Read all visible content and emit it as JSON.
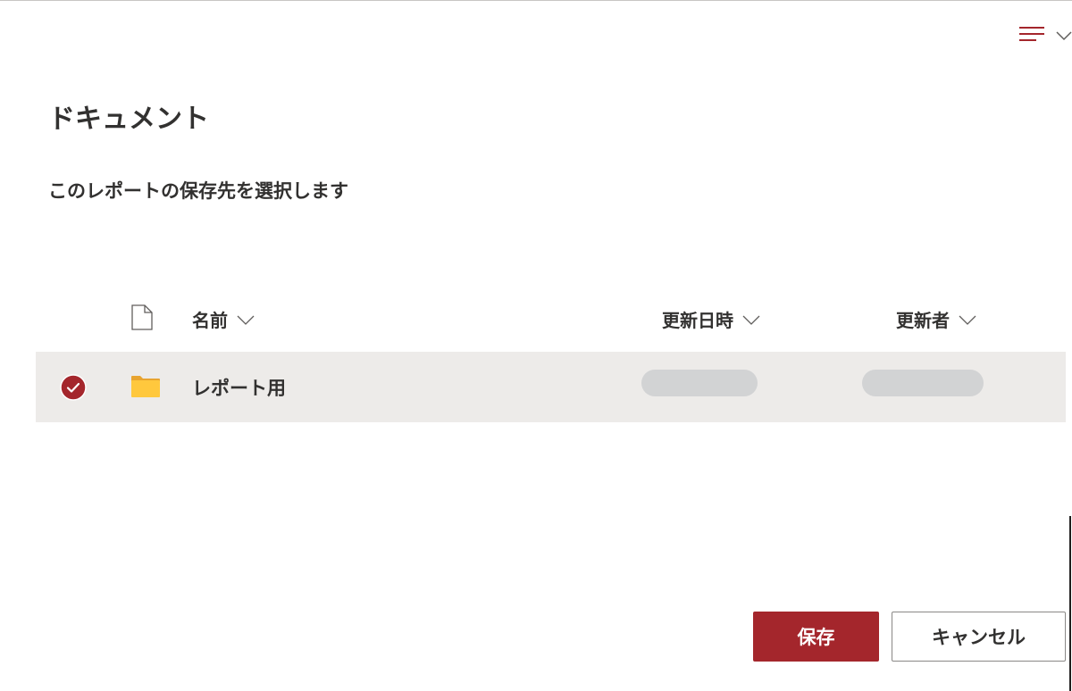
{
  "page": {
    "title": "ドキュメント",
    "subtitle": "このレポートの保存先を選択します"
  },
  "toolbar": {
    "view_icon": "list-lines-icon",
    "chevron_icon": "chevron-down-icon"
  },
  "columns": {
    "file_type_icon": "document-icon",
    "name": "名前",
    "modified": "更新日時",
    "modified_by": "更新者"
  },
  "rows": [
    {
      "name": "レポート用",
      "selected": true,
      "icon": "folder-icon",
      "modified": "",
      "modified_by": ""
    }
  ],
  "buttons": {
    "save": "保存",
    "cancel": "キャンセル"
  },
  "colors": {
    "accent": "#a4262c",
    "row_selected_bg": "#edebe9",
    "folder": "#ffc83d",
    "placeholder": "#d2d3d4",
    "text": "#323130"
  }
}
